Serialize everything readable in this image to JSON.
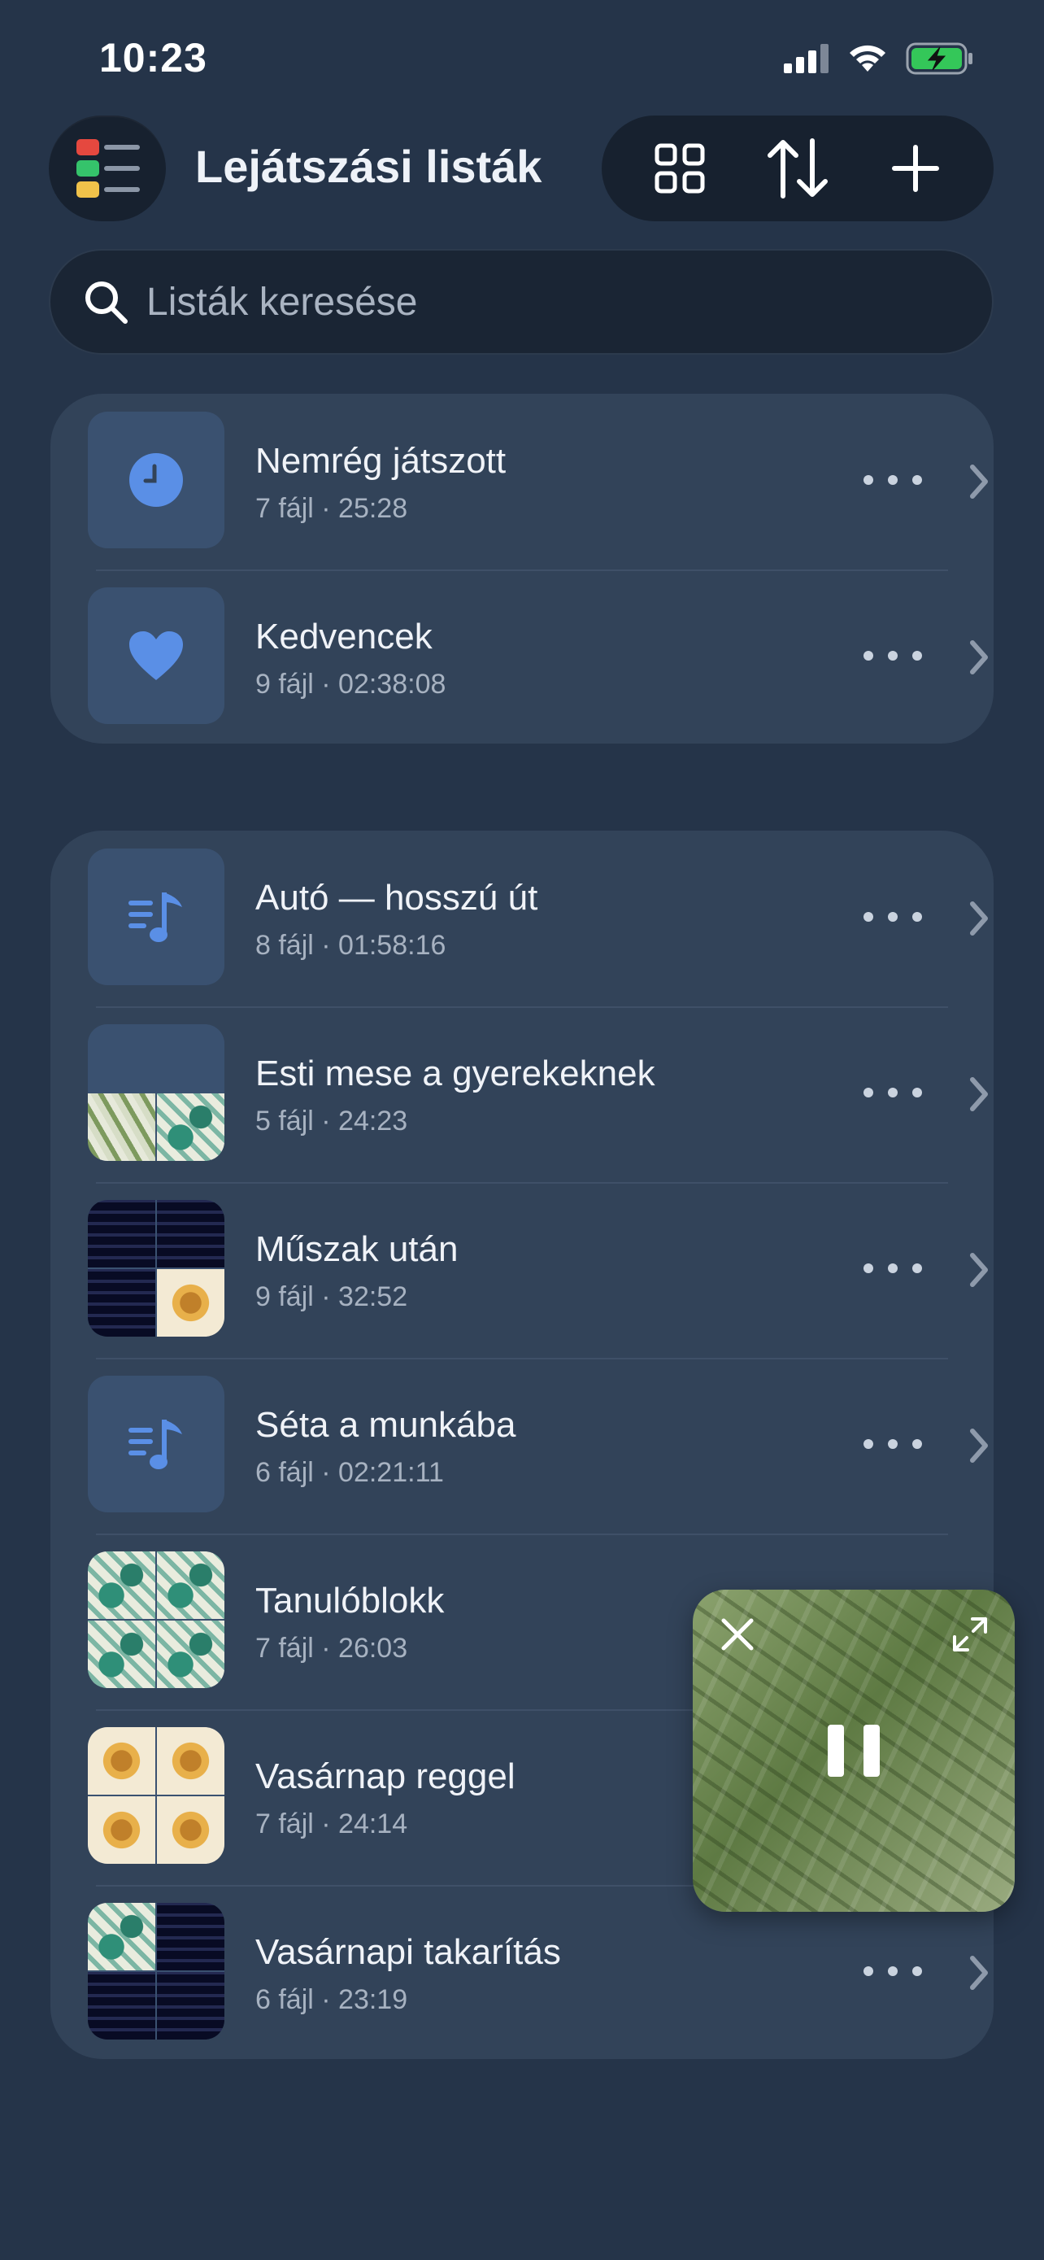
{
  "status_bar": {
    "time": "10:23",
    "icons": [
      "signal-icon",
      "wifi-icon",
      "battery-charging-icon"
    ],
    "battery_color": "#34c759"
  },
  "header": {
    "title": "Lejátszási listák",
    "menu_icon": "menu-list-icon",
    "menu_icon_colors": [
      "#e5483f",
      "#35c36b",
      "#f0c24a"
    ],
    "toolbar": [
      "grid-view-icon",
      "sort-icon",
      "add-icon"
    ]
  },
  "search": {
    "placeholder": "Listák keresése",
    "value": ""
  },
  "smart_lists": [
    {
      "title": "Nemrég játszott",
      "subtitle": "7 fájl · 25:28",
      "icon": "clock-icon"
    },
    {
      "title": "Kedvencek",
      "subtitle": "9 fájl · 02:38:08",
      "icon": "heart-icon"
    }
  ],
  "playlists": [
    {
      "title": "Autó — hosszú út",
      "subtitle": "8 fájl · 01:58:16",
      "thumb": "music-note-icon"
    },
    {
      "title": "Esti mese a gyerekeknek",
      "subtitle": "5 fájl · 24:23",
      "thumb": "mosaic"
    },
    {
      "title": "Műszak után",
      "subtitle": "9 fájl · 32:52",
      "thumb": "mosaic"
    },
    {
      "title": "Séta a munkába",
      "subtitle": "6 fájl · 02:21:11",
      "thumb": "music-note-icon"
    },
    {
      "title": "Tanulóblokk",
      "subtitle": "7 fájl · 26:03",
      "thumb": "mosaic"
    },
    {
      "title": "Vasárnap reggel",
      "subtitle": "7 fájl · 24:14",
      "thumb": "mosaic"
    },
    {
      "title": "Vasárnapi takarítás",
      "subtitle": "6 fájl · 23:19",
      "thumb": "mosaic"
    }
  ],
  "mini_player": {
    "state": "playing",
    "controls": [
      "close-icon",
      "expand-icon",
      "pause-icon"
    ]
  },
  "accent_color": "#5a8fe6"
}
